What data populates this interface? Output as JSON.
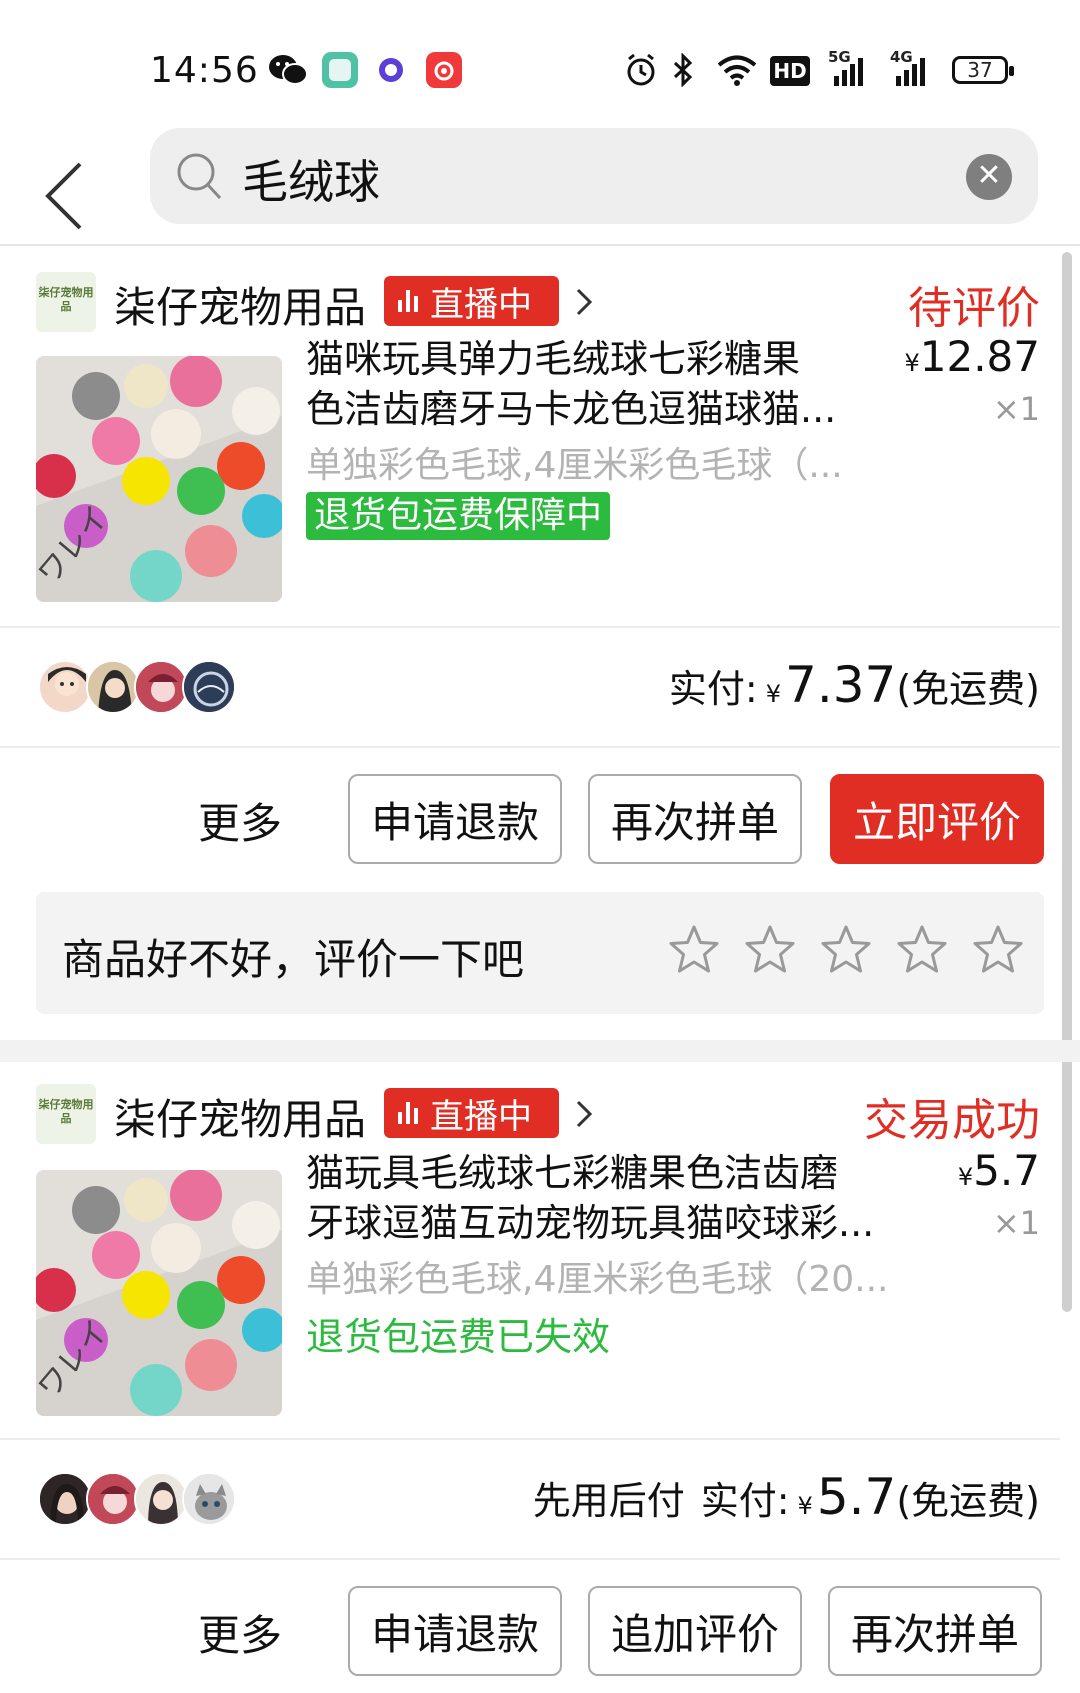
{
  "status_bar": {
    "time": "14:56",
    "signal_5g": "5G",
    "signal_4g": "4G",
    "hd_label": "HD",
    "battery": "37"
  },
  "search": {
    "query": "毛绒球",
    "back_icon": "chevron-left-icon",
    "search_icon": "search-icon",
    "clear_icon": "close-circle-icon"
  },
  "orders": [
    {
      "shop_logo_text": "柒仔宠物用品",
      "shop_name": "柒仔宠物用品",
      "live_label": "直播中",
      "status": "待评价",
      "title_line1": "猫咪玩具弹力毛绒球七彩糖果",
      "title_line2": "色洁齿磨牙马卡龙色逗猫球猫...",
      "price": "12.87",
      "quantity": "×1",
      "spec": "单独彩色毛球,4厘米彩色毛球（...",
      "guarantee": "退货包运费保障中",
      "paid_label": "实付:",
      "paid_amount": "7.37",
      "shipping_note": "(免运费)",
      "actions": {
        "more": "更多",
        "refund": "申请退款",
        "reorder": "再次拼单",
        "review": "立即评价"
      },
      "rate_prompt": "商品好不好，评价一下吧",
      "star_rating": 0
    },
    {
      "shop_logo_text": "柒仔宠物用品",
      "shop_name": "柒仔宠物用品",
      "live_label": "直播中",
      "status": "交易成功",
      "title_line1": "猫玩具毛绒球七彩糖果色洁齿磨",
      "title_line2": "牙球逗猫互动宠物玩具猫咬球彩...",
      "price": "5.7",
      "quantity": "×1",
      "spec": "单独彩色毛球,4厘米彩色毛球（20...",
      "guarantee": "退货包运费已失效",
      "pay_later": "先用后付",
      "paid_label": "实付:",
      "paid_amount": "5.7",
      "shipping_note": "(免运费)",
      "actions": {
        "more": "更多",
        "refund": "申请退款",
        "add_review": "追加评价",
        "reorder": "再次拼单"
      }
    }
  ],
  "currency_symbol": "¥",
  "colors": {
    "accent_red": "#e02e24",
    "guarantee_green": "#2dbb3f"
  }
}
